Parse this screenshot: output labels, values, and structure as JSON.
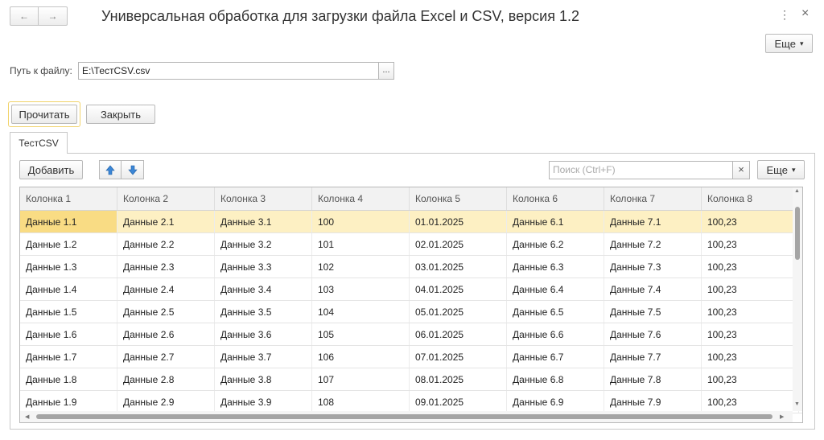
{
  "window": {
    "title": "Универсальная обработка для загрузки файла Excel и CSV, версия 1.2",
    "more_icon": "⋮",
    "close_icon": "×"
  },
  "nav": {
    "back": "←",
    "forward": "→"
  },
  "header_more": {
    "label": "Еще",
    "arrow": "▾"
  },
  "file": {
    "label": "Путь к файлу:",
    "value": "E:\\ТестCSV.csv",
    "select_label": "..."
  },
  "actions": {
    "read_label": "Прочитать",
    "close_label": "Закрыть"
  },
  "tab": {
    "label": "ТестCSV"
  },
  "toolbar": {
    "add_label": "Добавить",
    "up_icon": "arrow-up-icon",
    "down_icon": "arrow-down-icon",
    "search_placeholder": "Поиск (Ctrl+F)",
    "clear_icon": "×",
    "more_label": "Еще",
    "more_arrow": "▾"
  },
  "table": {
    "columns": [
      "Колонка 1",
      "Колонка 2",
      "Колонка 3",
      "Колонка 4",
      "Колонка 5",
      "Колонка 6",
      "Колонка 7",
      "Колонка 8"
    ],
    "rows": [
      [
        "Данные 1.1",
        "Данные 2.1",
        "Данные 3.1",
        "100",
        "01.01.2025",
        "Данные 6.1",
        "Данные 7.1",
        "100,23"
      ],
      [
        "Данные 1.2",
        "Данные 2.2",
        "Данные 3.2",
        "101",
        "02.01.2025",
        "Данные 6.2",
        "Данные 7.2",
        "100,23"
      ],
      [
        "Данные 1.3",
        "Данные 2.3",
        "Данные 3.3",
        "102",
        "03.01.2025",
        "Данные 6.3",
        "Данные 7.3",
        "100,23"
      ],
      [
        "Данные 1.4",
        "Данные 2.4",
        "Данные 3.4",
        "103",
        "04.01.2025",
        "Данные 6.4",
        "Данные 7.4",
        "100,23"
      ],
      [
        "Данные 1.5",
        "Данные 2.5",
        "Данные 3.5",
        "104",
        "05.01.2025",
        "Данные 6.5",
        "Данные 7.5",
        "100,23"
      ],
      [
        "Данные 1.6",
        "Данные 2.6",
        "Данные 3.6",
        "105",
        "06.01.2025",
        "Данные 6.6",
        "Данные 7.6",
        "100,23"
      ],
      [
        "Данные 1.7",
        "Данные 2.7",
        "Данные 3.7",
        "106",
        "07.01.2025",
        "Данные 6.7",
        "Данные 7.7",
        "100,23"
      ],
      [
        "Данные 1.8",
        "Данные 2.8",
        "Данные 3.8",
        "107",
        "08.01.2025",
        "Данные 6.8",
        "Данные 7.8",
        "100,23"
      ],
      [
        "Данные 1.9",
        "Данные 2.9",
        "Данные 3.9",
        "108",
        "09.01.2025",
        "Данные 6.9",
        "Данные 7.9",
        "100,23"
      ]
    ],
    "selected_row": 0
  },
  "colors": {
    "selected_row": "#fdf0c3",
    "selected_cell": "#f9dc84",
    "focus_border": "#f1d36b",
    "arrow_blue": "#3b86d6"
  }
}
